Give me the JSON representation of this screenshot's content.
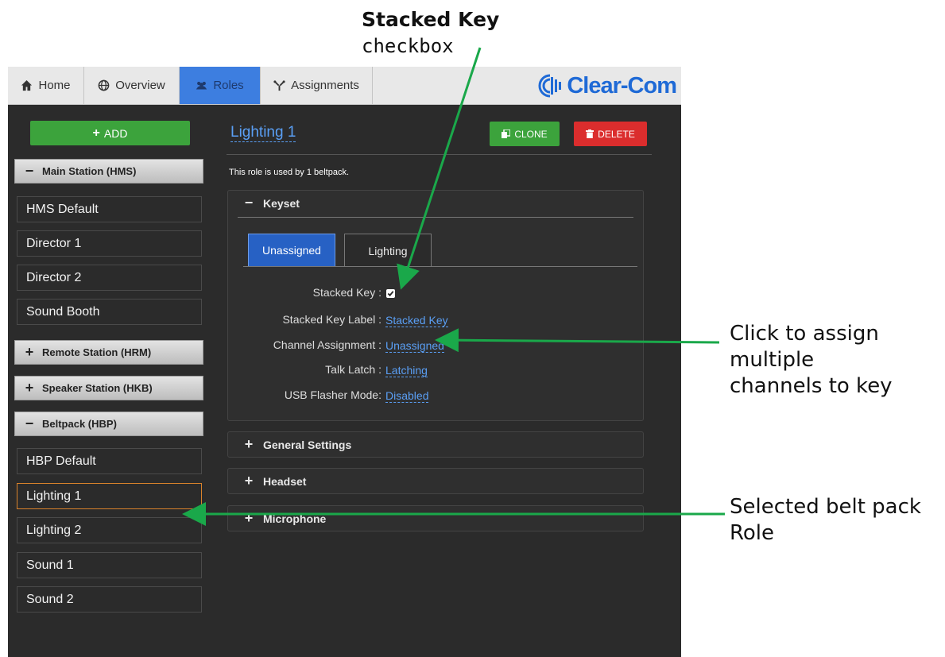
{
  "annotations": {
    "stacked_key_title": "Stacked Key",
    "stacked_key_sub": "checkbox",
    "assign_lines": [
      "Click to assign",
      "multiple",
      "channels to key"
    ],
    "selected_lines": [
      "Selected belt pack",
      "Role"
    ],
    "arrow_color": "#1aa84a"
  },
  "tabs": [
    {
      "label": "Home",
      "icon": "home-icon",
      "active": false
    },
    {
      "label": "Overview",
      "icon": "globe-icon",
      "active": false
    },
    {
      "label": "Roles",
      "icon": "users-icon",
      "active": true
    },
    {
      "label": "Assignments",
      "icon": "assignments-icon",
      "active": false
    }
  ],
  "logo": {
    "text": "Clear-Com"
  },
  "sidebar": {
    "add_label": "ADD",
    "groups": {
      "hms": {
        "label": "Main Station (HMS)",
        "expanded": true,
        "items": [
          "HMS Default",
          "Director 1",
          "Director 2",
          "Sound Booth"
        ]
      },
      "hrm": {
        "label": "Remote Station (HRM)",
        "expanded": false
      },
      "hkb": {
        "label": "Speaker Station (HKB)",
        "expanded": false
      },
      "hbp": {
        "label": "Beltpack (HBP)",
        "expanded": true,
        "items": [
          "HBP Default",
          "Lighting 1",
          "Lighting 2",
          "Sound 1",
          "Sound 2"
        ],
        "selected": "Lighting 1"
      }
    },
    "minus": "−",
    "plus": "+"
  },
  "main": {
    "role_title": "Lighting 1",
    "clone_label": "CLONE",
    "delete_label": "DELETE",
    "used_by": "This role is used by 1 beltpack.",
    "keyset": {
      "header": "Keyset",
      "tabs": [
        "Unassigned",
        "Lighting"
      ],
      "rows": {
        "stacked_key": {
          "label": "Stacked Key :",
          "checked": true
        },
        "stacked_key_label": {
          "label": "Stacked Key Label :",
          "value": "Stacked Key"
        },
        "channel_assignment": {
          "label": "Channel Assignment :",
          "value": "Unassigned"
        },
        "talk_latch": {
          "label": "Talk Latch :",
          "value": "Latching"
        },
        "usb_flasher": {
          "label": "USB Flasher Mode:",
          "value": "Disabled"
        }
      }
    },
    "sections": {
      "general": "General Settings",
      "headset": "Headset",
      "microphone": "Microphone"
    }
  },
  "colors": {
    "tab_active": "#3d7ee0",
    "add_green": "#3ca33c",
    "delete_red": "#db2d2d",
    "link_blue": "#5a9ff5",
    "selected_border": "#d9822b"
  }
}
